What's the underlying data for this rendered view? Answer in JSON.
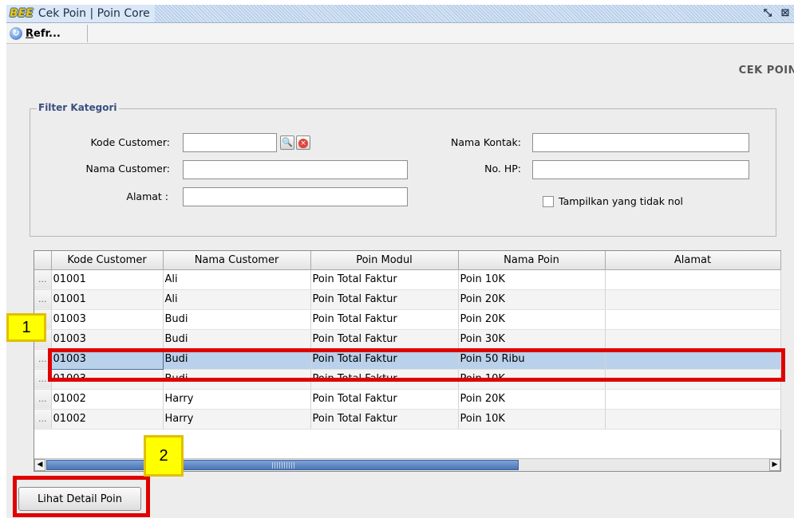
{
  "window": {
    "logo": "BEE",
    "title": "Cek Poin | Poin Core",
    "buttons": {
      "restore": "⤡",
      "close": "⊠"
    }
  },
  "toolbar": {
    "refresh_mnemonic": "R",
    "refresh_rest": "efr..."
  },
  "page": {
    "heading": "CEK POIN"
  },
  "filter": {
    "legend": "Filter Kategori",
    "kode_customer_label": "Kode Customer:",
    "nama_customer_label": "Nama Customer:",
    "alamat_label": "Alamat :",
    "nama_kontak_label": "Nama Kontak:",
    "no_hp_label": "No. HP:",
    "checkbox_label": "Tampilkan yang tidak nol",
    "kode_customer_value": "",
    "nama_customer_value": "",
    "alamat_value": "",
    "nama_kontak_value": "",
    "no_hp_value": ""
  },
  "table": {
    "headers": [
      "Kode Customer",
      "Nama Customer",
      "Poin Modul",
      "Nama Poin",
      "Alamat"
    ],
    "row_marker": "...",
    "rows": [
      [
        "01001",
        "Ali",
        "Poin Total Faktur",
        "Poin 10K",
        ""
      ],
      [
        "01001",
        "Ali",
        "Poin Total Faktur",
        "Poin 20K",
        ""
      ],
      [
        "01003",
        "Budi",
        "Poin Total Faktur",
        "Poin 20K",
        ""
      ],
      [
        "01003",
        "Budi",
        "Poin Total Faktur",
        "Poin 30K",
        ""
      ],
      [
        "01003",
        "Budi",
        "Poin Total Faktur",
        "Poin 50 Ribu",
        ""
      ],
      [
        "01003",
        "Budi",
        "Poin Total Faktur",
        "Poin 10K",
        ""
      ],
      [
        "01002",
        "Harry",
        "Poin Total Faktur",
        "Poin 20K",
        ""
      ],
      [
        "01002",
        "Harry",
        "Poin Total Faktur",
        "Poin 10K",
        ""
      ]
    ],
    "selected_row": 4
  },
  "actions": {
    "detail_button": "Lihat Detail Poin"
  },
  "annotations": {
    "one": "1",
    "two": "2"
  },
  "colors": {
    "annotation_border": "#e00000",
    "annotation_label_bg": "#ffff00",
    "selection": "#b9d1ea"
  }
}
